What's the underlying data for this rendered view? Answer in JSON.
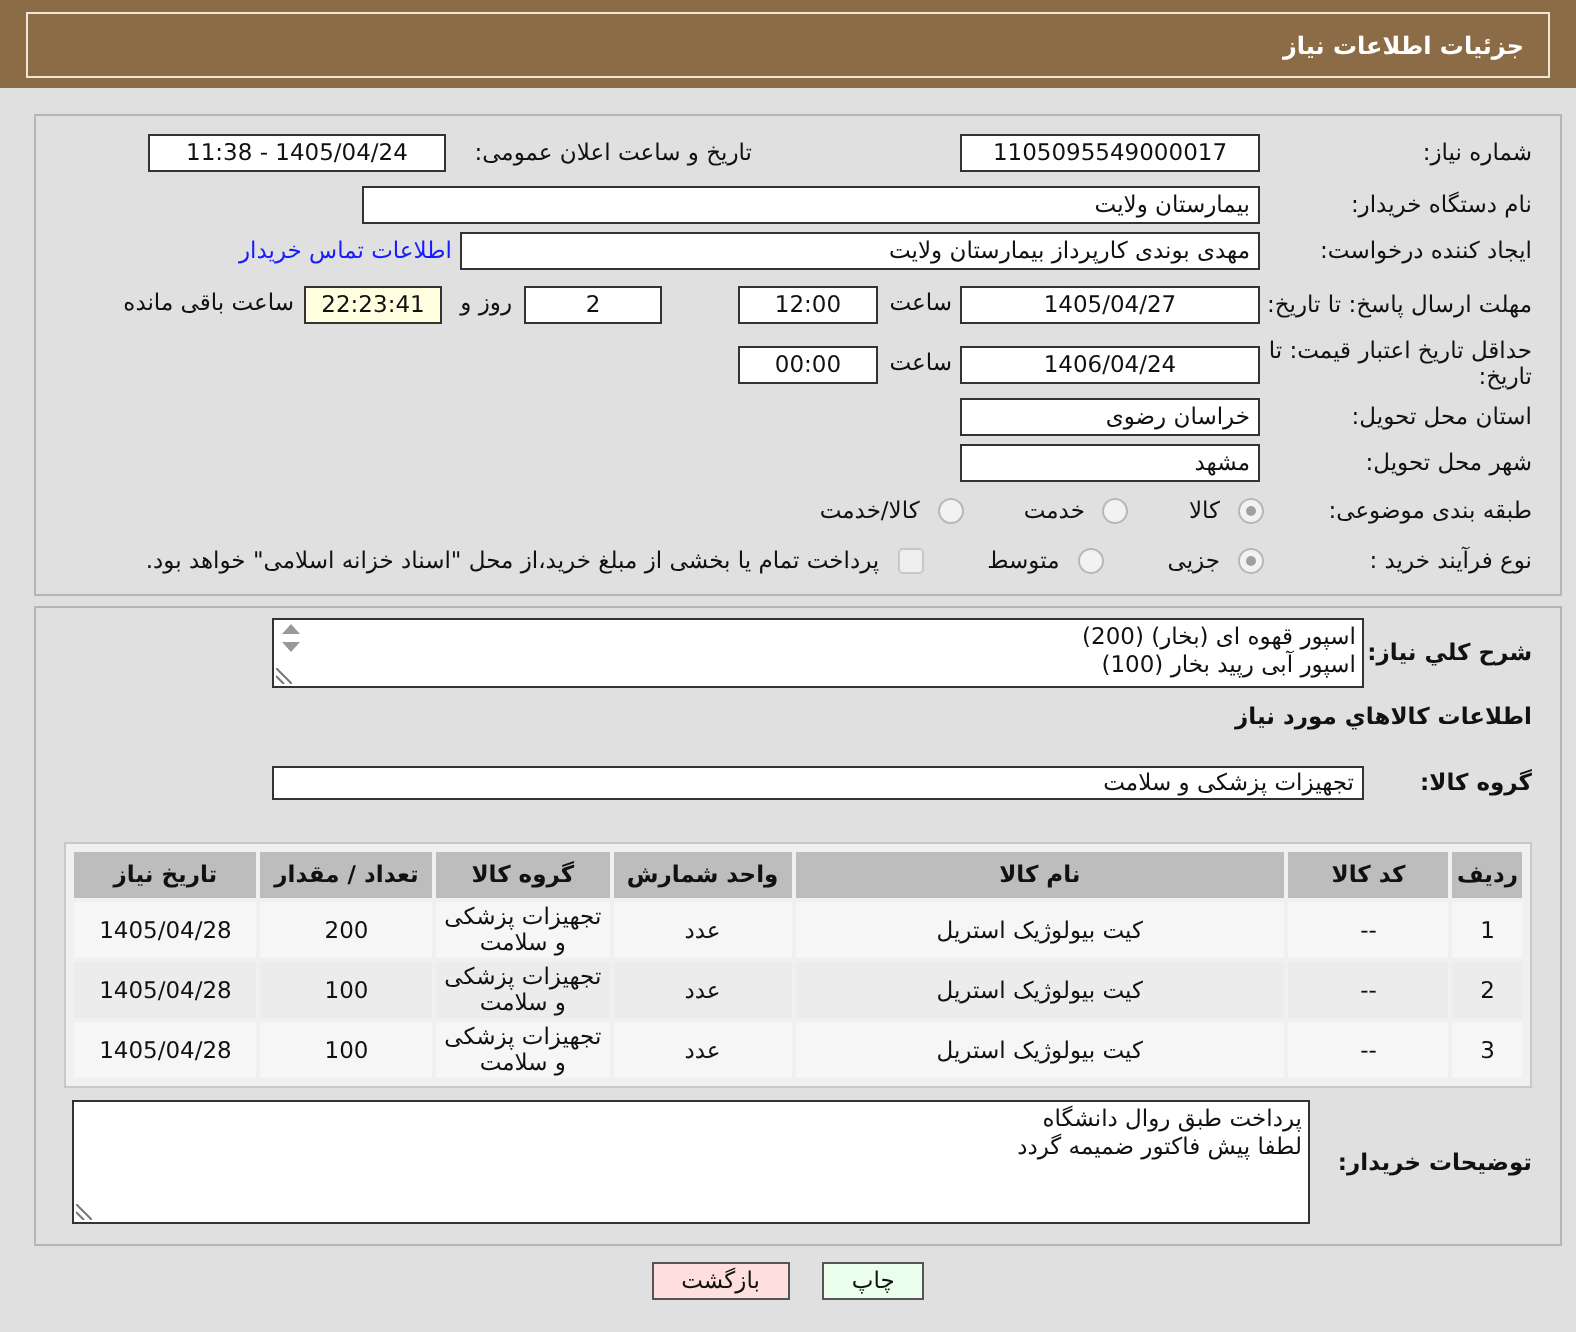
{
  "header": {
    "title": "جزئیات اطلاعات نیاز"
  },
  "need_number": {
    "label": "شماره نیاز:",
    "value": "1105095549000017"
  },
  "announce": {
    "label": "تاریخ و ساعت اعلان عمومی:",
    "value": "1405/04/24 - 11:38"
  },
  "buyer_org": {
    "label": "نام دستگاه خریدار:",
    "value": "بیمارستان ولایت"
  },
  "requester": {
    "label": "ایجاد کننده درخواست:",
    "value": "مهدی بوندی کارپرداز بیمارستان ولایت",
    "link": "اطلاعات تماس خریدار"
  },
  "deadline": {
    "label": "مهلت ارسال پاسخ: تا تاریخ:",
    "date": "1405/04/27",
    "time_label": "ساعت",
    "time": "12:00",
    "days": "2",
    "days_label": "روز و",
    "remaining": "22:23:41",
    "remaining_label": "ساعت باقی مانده"
  },
  "validity": {
    "label": "حداقل تاریخ اعتبار قیمت: تا تاریخ:",
    "date": "1406/04/24",
    "time_label": "ساعت",
    "time": "00:00"
  },
  "province": {
    "label": "استان محل تحویل:",
    "value": "خراسان رضوی"
  },
  "city": {
    "label": "شهر محل تحویل:",
    "value": "مشهد"
  },
  "category": {
    "label": "طبقه بندی موضوعی:",
    "options": [
      {
        "label": "کالا",
        "selected": true,
        "disabled": true
      },
      {
        "label": "خدمت",
        "selected": false,
        "disabled": true
      },
      {
        "label": "کالا/خدمت",
        "selected": false,
        "disabled": true
      }
    ]
  },
  "process": {
    "label": "نوع فرآیند خرید :",
    "options": [
      {
        "label": "جزیی",
        "selected": true,
        "disabled": true
      },
      {
        "label": "متوسط",
        "selected": false,
        "disabled": true
      }
    ],
    "checkbox": {
      "label": "پرداخت تمام یا بخشی از مبلغ خرید،از محل \"اسناد خزانه اسلامی\" خواهد بود.",
      "checked": false,
      "disabled": true
    }
  },
  "description": {
    "label": "شرح کلي نیاز:",
    "lines": [
      "اسپور قهوه ای (بخار)  (200)",
      "اسپور آبی رپید بخار     (100)"
    ]
  },
  "goods_title": "اطلاعات کالاهاي مورد نیاز",
  "goods_group": {
    "label": "گروه کالا:",
    "value": "تجهیزات پزشکی و سلامت"
  },
  "table": {
    "columns": [
      "ردیف",
      "کد کالا",
      "نام کالا",
      "واحد شمارش",
      "گروه کالا",
      "تعداد / مقدار",
      "تاریخ نیاز"
    ],
    "rows": [
      [
        "1",
        "--",
        "کیت بیولوژیک استریل",
        "عدد",
        "تجهیزات پزشکی و سلامت",
        "200",
        "1405/04/28"
      ],
      [
        "2",
        "--",
        "کیت بیولوژیک استریل",
        "عدد",
        "تجهیزات پزشکی و سلامت",
        "100",
        "1405/04/28"
      ],
      [
        "3",
        "--",
        "کیت بیولوژیک استریل",
        "عدد",
        "تجهیزات پزشکی و سلامت",
        "100",
        "1405/04/28"
      ]
    ]
  },
  "buyer_notes": {
    "label": "توضیحات خریدار:",
    "lines": [
      "پرداخت طبق روال دانشگاه",
      "لطفا پیش فاکتور ضمیمه گردد"
    ]
  },
  "buttons": [
    {
      "label": "چاپ",
      "kind": "print"
    },
    {
      "label": "بازگشت",
      "kind": "back"
    }
  ]
}
